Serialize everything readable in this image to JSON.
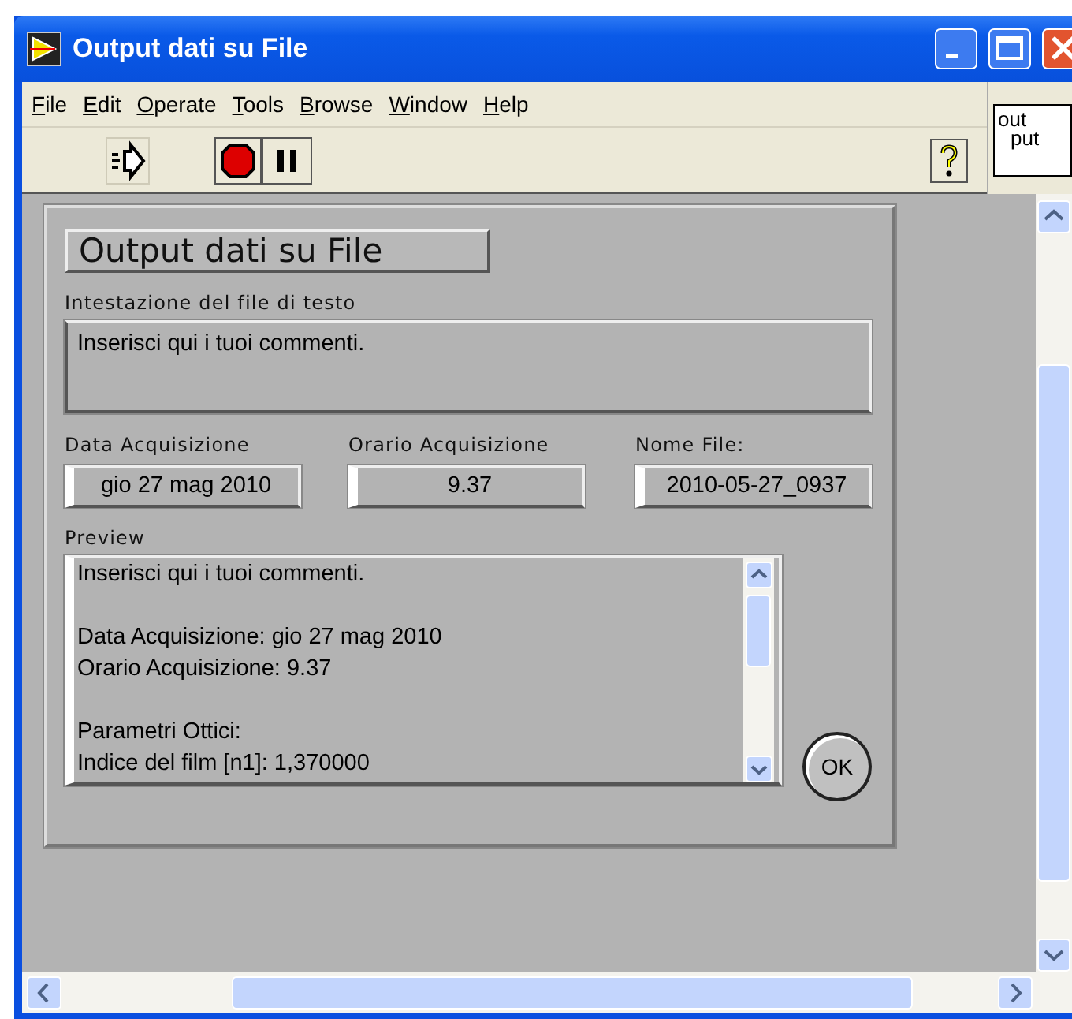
{
  "window": {
    "title": "Output dati su File"
  },
  "menu": [
    "File",
    "Edit",
    "Operate",
    "Tools",
    "Browse",
    "Window",
    "Help"
  ],
  "vi_icon": {
    "lines": [
      "out",
      "put"
    ]
  },
  "front_panel": {
    "title": "Output dati su File",
    "header": {
      "label": "Intestazione del file di testo",
      "value": "Inserisci qui i tuoi commenti."
    },
    "fields": [
      {
        "label": "Data Acquisizione",
        "value": "gio 27 mag 2010"
      },
      {
        "label": "Orario Acquisizione",
        "value": "9.37"
      },
      {
        "label": "Nome File:",
        "value": "2010-05-27_0937"
      }
    ],
    "preview": {
      "label": "Preview",
      "paragraphs": [
        [
          "Inserisci qui i tuoi commenti."
        ],
        [
          "Data Acquisizione: gio 27 mag 2010",
          "Orario Acquisizione: 9.37"
        ],
        [
          "Parametri Ottici:",
          "Indice del film [n1]: 1,370000"
        ]
      ]
    },
    "ok_button": "OK"
  }
}
